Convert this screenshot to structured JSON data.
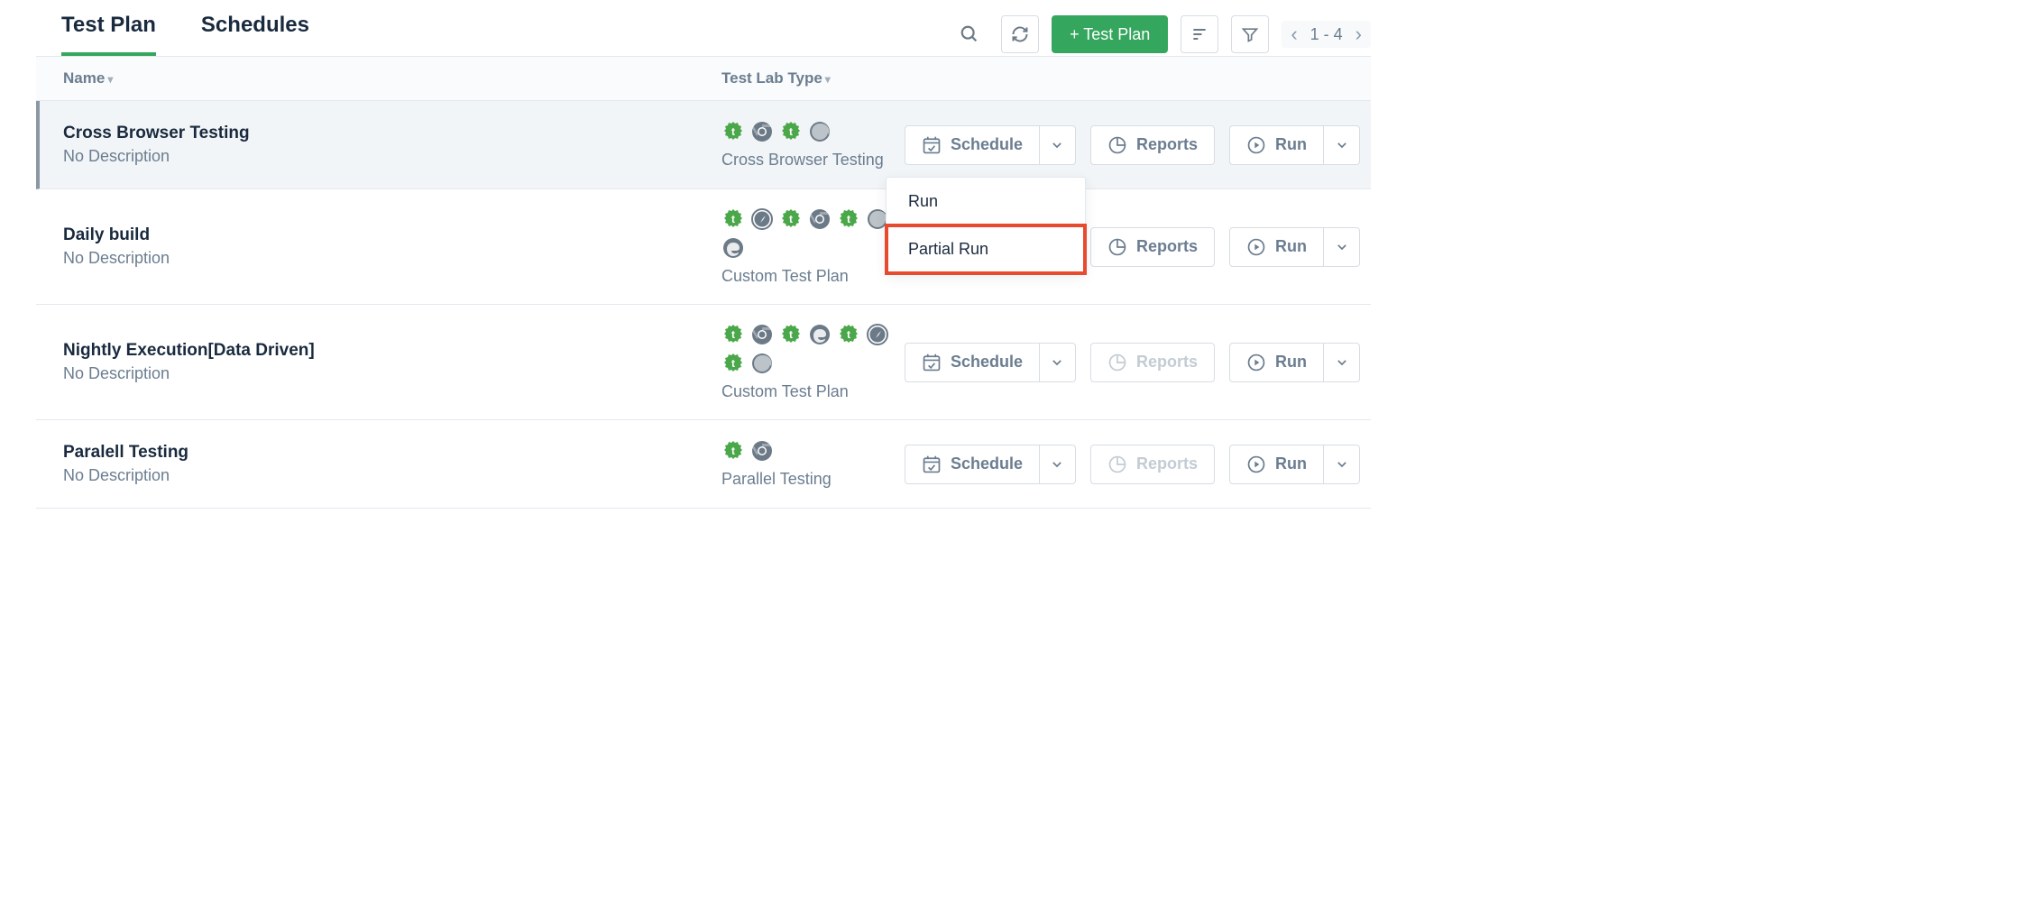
{
  "tabs": {
    "testplan": "Test Plan",
    "schedules": "Schedules",
    "active": "testplan"
  },
  "toolbar": {
    "add_button": "+ Test Plan"
  },
  "pager": {
    "range": "1 - 4"
  },
  "table": {
    "col_name": "Name",
    "col_lab": "Test Lab Type"
  },
  "buttons": {
    "schedule": "Schedule",
    "reports": "Reports",
    "run": "Run"
  },
  "dropdown": {
    "run": "Run",
    "partial": "Partial Run"
  },
  "rows": [
    {
      "name": "Cross Browser Testing",
      "desc": "No Description",
      "lab_label": "Cross Browser Testing",
      "icons": [
        "ts-green",
        "chrome",
        "ts-green",
        "firefox"
      ],
      "active": true,
      "reports_disabled": false,
      "show_schedule": true,
      "show_dropdown": true
    },
    {
      "name": "Daily build",
      "desc": "No Description",
      "lab_label": "Custom Test Plan",
      "icons": [
        "ts-green",
        "safari",
        "ts-green",
        "chrome",
        "ts-green",
        "firefox",
        "ts-green",
        "edge"
      ],
      "active": false,
      "reports_disabled": false,
      "show_schedule": false,
      "show_dropdown": false
    },
    {
      "name": "Nightly Execution[Data Driven]",
      "desc": "No Description",
      "lab_label": "Custom Test Plan",
      "icons": [
        "ts-green",
        "chrome",
        "ts-green",
        "edge",
        "ts-green",
        "safari",
        "ts-green",
        "firefox"
      ],
      "active": false,
      "reports_disabled": true,
      "show_schedule": true,
      "show_dropdown": false
    },
    {
      "name": "Paralell Testing",
      "desc": "No Description",
      "lab_label": "Parallel Testing",
      "icons": [
        "ts-green",
        "chrome"
      ],
      "active": false,
      "reports_disabled": true,
      "show_schedule": true,
      "show_dropdown": false
    }
  ]
}
